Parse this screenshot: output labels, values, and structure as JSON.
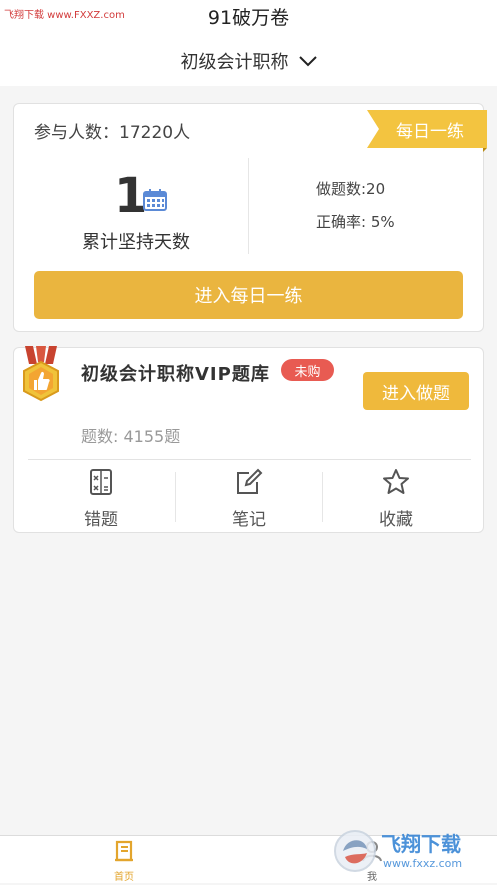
{
  "watermark": {
    "text": "飞翔下载 www.FXXZ.com",
    "logo_text_cn": "飞翔下载",
    "logo_text_url": "www.fxxz.com"
  },
  "header": {
    "title": "91破万卷",
    "subject": "初级会计职称"
  },
  "daily_card": {
    "participants": "参与人数：17220人",
    "ribbon": "每日一练",
    "streak_days": "1",
    "streak_label": "累计坚持天数",
    "questions_done": "做题数:20",
    "accuracy": "正确率: 5%",
    "enter_button": "进入每日一练"
  },
  "course_card": {
    "title": "初级会计职称VIP题库",
    "badge": "未购",
    "enter_button": "进入做题",
    "question_count": "题数: 4155题",
    "actions": [
      {
        "label": "错题",
        "icon": "wrong-questions-icon"
      },
      {
        "label": "笔记",
        "icon": "note-edit-icon"
      },
      {
        "label": "收藏",
        "icon": "star-icon"
      }
    ]
  },
  "tabbar": {
    "home": {
      "label": "首页",
      "active": true
    },
    "me": {
      "label": "我",
      "active": false
    }
  },
  "colors": {
    "accent": "#eab53f",
    "ribbon": "#f3c440",
    "badge": "#e85b52",
    "tab_active": "#e3a52d"
  }
}
